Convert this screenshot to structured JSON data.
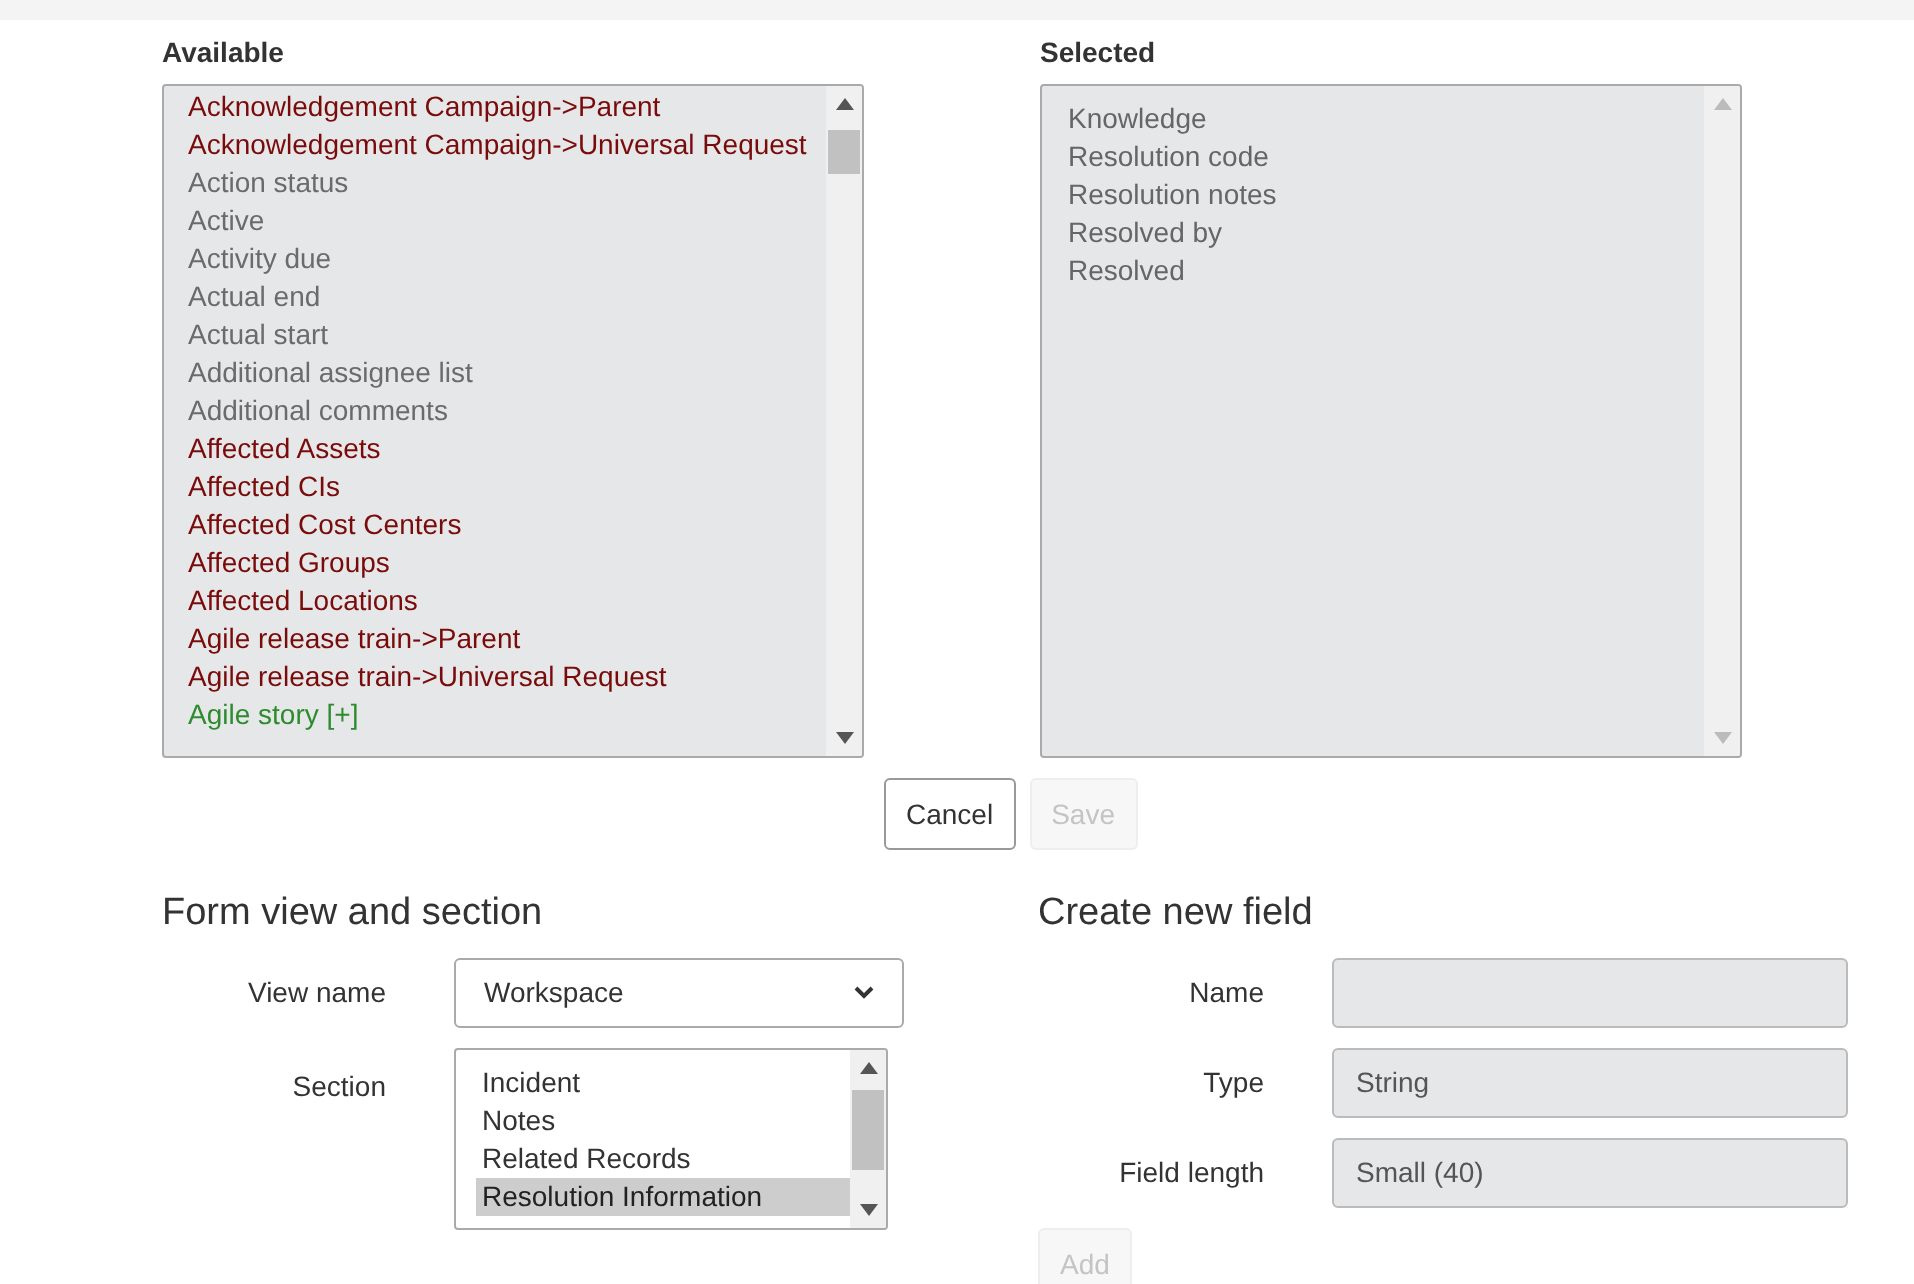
{
  "available": {
    "label": "Available",
    "items": [
      {
        "text": "Acknowledgement Campaign->Parent",
        "kind": "reference"
      },
      {
        "text": "Acknowledgement Campaign->Universal Request",
        "kind": "reference"
      },
      {
        "text": "Action status",
        "kind": "field"
      },
      {
        "text": "Active",
        "kind": "field"
      },
      {
        "text": "Activity due",
        "kind": "field"
      },
      {
        "text": "Actual end",
        "kind": "field"
      },
      {
        "text": "Actual start",
        "kind": "field"
      },
      {
        "text": "Additional assignee list",
        "kind": "field"
      },
      {
        "text": "Additional comments",
        "kind": "field"
      },
      {
        "text": "Affected Assets",
        "kind": "reference"
      },
      {
        "text": "Affected CIs",
        "kind": "reference"
      },
      {
        "text": "Affected Cost Centers",
        "kind": "reference"
      },
      {
        "text": "Affected Groups",
        "kind": "reference"
      },
      {
        "text": "Affected Locations",
        "kind": "reference"
      },
      {
        "text": "Agile release train->Parent",
        "kind": "reference"
      },
      {
        "text": "Agile release train->Universal Request",
        "kind": "reference"
      },
      {
        "text": "Agile story [+]",
        "kind": "expandable"
      }
    ]
  },
  "selected": {
    "label": "Selected",
    "items": [
      "Knowledge",
      "Resolution code",
      "Resolution notes",
      "Resolved by",
      "Resolved"
    ]
  },
  "buttons": [
    {
      "label": "Cancel",
      "disabled": false
    },
    {
      "label": "Save",
      "disabled": true
    }
  ],
  "form_view": {
    "title": "Form view and section",
    "view_name": {
      "label": "View name",
      "value": "Workspace"
    },
    "section": {
      "label": "Section",
      "items": [
        {
          "text": "Incident",
          "selected": false
        },
        {
          "text": "Notes",
          "selected": false
        },
        {
          "text": "Related Records",
          "selected": false
        },
        {
          "text": "Resolution Information",
          "selected": true
        }
      ]
    }
  },
  "new_field": {
    "title": "Create new field",
    "fields": [
      {
        "label": "Name"
      },
      {
        "label": "Type",
        "value": "String"
      },
      {
        "label": "Field length",
        "value": "Small (40)"
      }
    ],
    "add_button": {
      "label": "Add",
      "disabled": true
    }
  }
}
